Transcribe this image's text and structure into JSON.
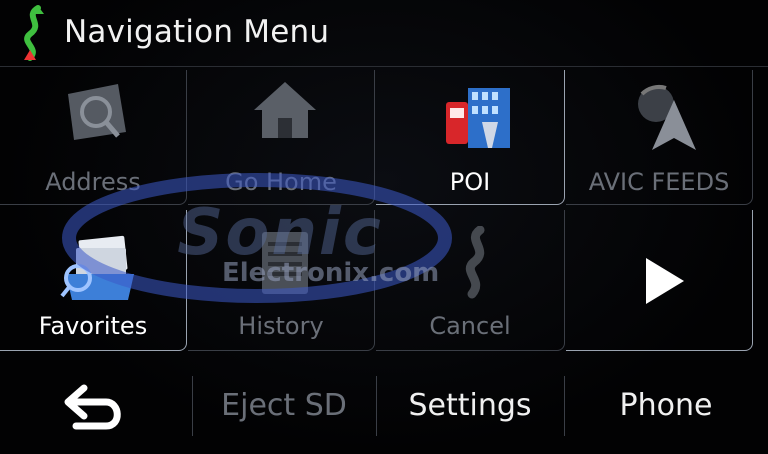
{
  "header": {
    "title": "Navigation Menu",
    "icon": "route-icon"
  },
  "tiles": [
    {
      "label": "Address",
      "icon": "map-search-icon",
      "active": false
    },
    {
      "label": "Go Home",
      "icon": "home-icon",
      "active": false
    },
    {
      "label": "POI",
      "icon": "poi-building-icon",
      "active": true
    },
    {
      "label": "AVIC FEEDS",
      "icon": "feeds-arrow-icon",
      "active": false
    },
    {
      "label": "Favorites",
      "icon": "favorites-cardfile-icon",
      "active": true
    },
    {
      "label": "History",
      "icon": "history-list-icon",
      "active": false
    },
    {
      "label": "Cancel",
      "icon": "cancel-route-icon",
      "active": false
    },
    {
      "label": "",
      "icon": "next-page-icon",
      "active": true
    }
  ],
  "bottom": {
    "back_icon": "back-arrow-icon",
    "eject": "Eject SD",
    "settings": "Settings",
    "phone": "Phone"
  },
  "watermark": {
    "brand": "Sonic",
    "sub": "Electronix.com"
  },
  "colors": {
    "active_text": "#ffffff",
    "inactive_text": "#6a6f78",
    "background": "#020203"
  }
}
